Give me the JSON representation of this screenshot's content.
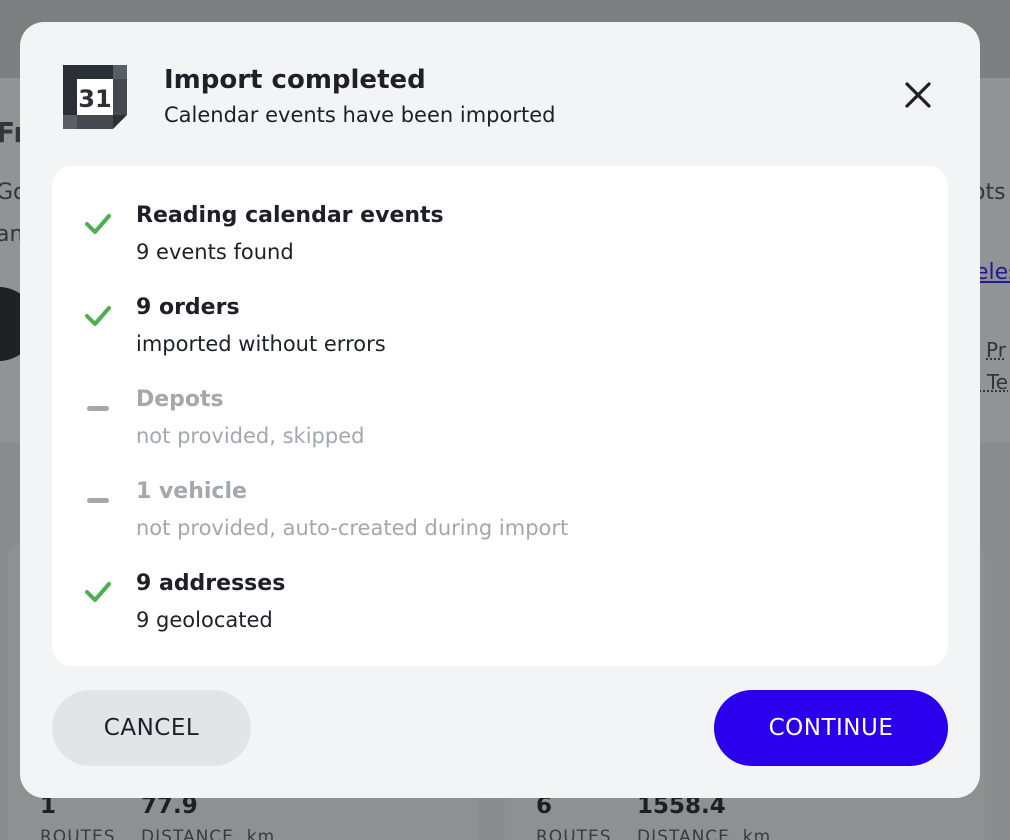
{
  "background": {
    "heading_fragment": "Fr",
    "text_fragment_1": "Go",
    "text_fragment_2": "an",
    "right_fragment_1": "ots",
    "right_link_fragment": "eles",
    "right_fragment_2": "Pr",
    "right_fragment_3": "l Te",
    "cards": [
      {
        "routes_value": "1",
        "routes_label": "ROUTES",
        "distance_value": "77.9",
        "distance_label": "DISTANCE, km"
      },
      {
        "routes_value": "6",
        "routes_label": "ROUTES",
        "distance_value": "1558.4",
        "distance_label": "DISTANCE, km"
      }
    ]
  },
  "modal": {
    "icon": "calendar-icon",
    "calendar_day": "31",
    "title": "Import completed",
    "subtitle": "Calendar events have been imported",
    "close_icon": "close-icon",
    "steps": [
      {
        "status": "done",
        "icon": "check-icon",
        "title": "Reading calendar events",
        "detail": "9 events found"
      },
      {
        "status": "done",
        "icon": "check-icon",
        "title": "9 orders",
        "detail": "imported without errors"
      },
      {
        "status": "skipped",
        "icon": "dash-icon",
        "title": "Depots",
        "detail": "not provided, skipped"
      },
      {
        "status": "skipped",
        "icon": "dash-icon",
        "title": "1 vehicle",
        "detail": "not provided, auto-created during import"
      },
      {
        "status": "done",
        "icon": "check-icon",
        "title": "9 addresses",
        "detail": "9 geolocated"
      }
    ],
    "cancel_label": "CANCEL",
    "continue_label": "CONTINUE"
  },
  "colors": {
    "accent": "#2a00ec",
    "success": "#4caf50",
    "muted": "#a4a7ac",
    "text": "#1d2027",
    "modal_bg": "#f3f4f6",
    "overlay": "#8b8c8e"
  }
}
